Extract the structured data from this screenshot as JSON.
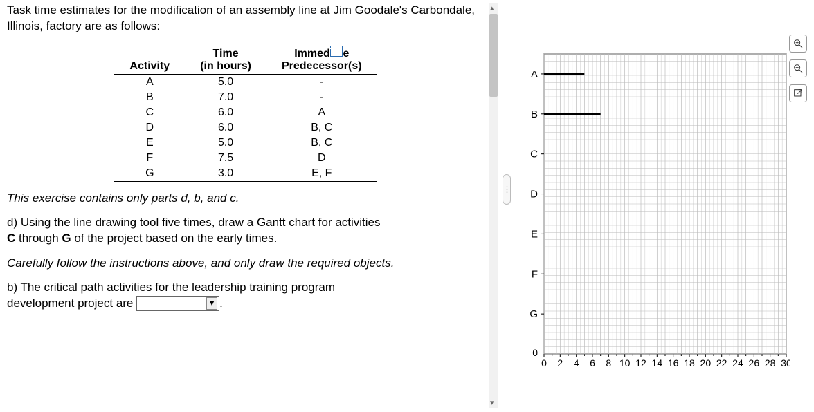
{
  "intro": "Task time estimates for the modification of an assembly line at Jim Goodale's Carbondale, Illinois, factory are as follows:",
  "table": {
    "headers": {
      "activity": "Activity",
      "time_l1": "Time",
      "time_l2": "(in hours)",
      "pred_l1": "Immediate",
      "pred_l2": "Predecessor(s)"
    },
    "rows": [
      {
        "activity": "A",
        "time": "5.0",
        "pred": "-"
      },
      {
        "activity": "B",
        "time": "7.0",
        "pred": "-"
      },
      {
        "activity": "C",
        "time": "6.0",
        "pred": "A"
      },
      {
        "activity": "D",
        "time": "6.0",
        "pred": "B, C"
      },
      {
        "activity": "E",
        "time": "5.0",
        "pred": "B, C"
      },
      {
        "activity": "F",
        "time": "7.5",
        "pred": "D"
      },
      {
        "activity": "G",
        "time": "3.0",
        "pred": "E, F"
      }
    ]
  },
  "note_contains": "This exercise contains only parts d, b, and c.",
  "part_d_l1": "d) Using the line drawing tool five times, draw a Gantt chart for activities",
  "part_d_l2_pre": "",
  "part_d_l2_bold": "C",
  "part_d_l2_mid": " through ",
  "part_d_l2_bold2": "G",
  "part_d_l2_post": " of the project based on the early times.",
  "care_note": "Carefully follow the instructions above, and only draw the required objects.",
  "part_b_l1": "b) The critical path activities for the leadership training program",
  "part_b_l2_pre": "development project are ",
  "part_b_l2_post": ".",
  "chart_data": {
    "type": "bar",
    "orientation": "horizontal",
    "categories": [
      "A",
      "B",
      "C",
      "D",
      "E",
      "F",
      "G"
    ],
    "series": [
      {
        "name": "Gantt",
        "start": [
          0,
          0,
          null,
          null,
          null,
          null,
          null
        ],
        "end": [
          5,
          7,
          null,
          null,
          null,
          null,
          null
        ]
      }
    ],
    "xlabel": "",
    "ylabel": "",
    "xlim": [
      0,
      30
    ],
    "x_ticks": [
      0,
      2,
      4,
      6,
      8,
      10,
      12,
      14,
      16,
      18,
      20,
      22,
      24,
      26,
      28,
      30
    ],
    "y_tick_bottom": "0",
    "grid": true
  }
}
